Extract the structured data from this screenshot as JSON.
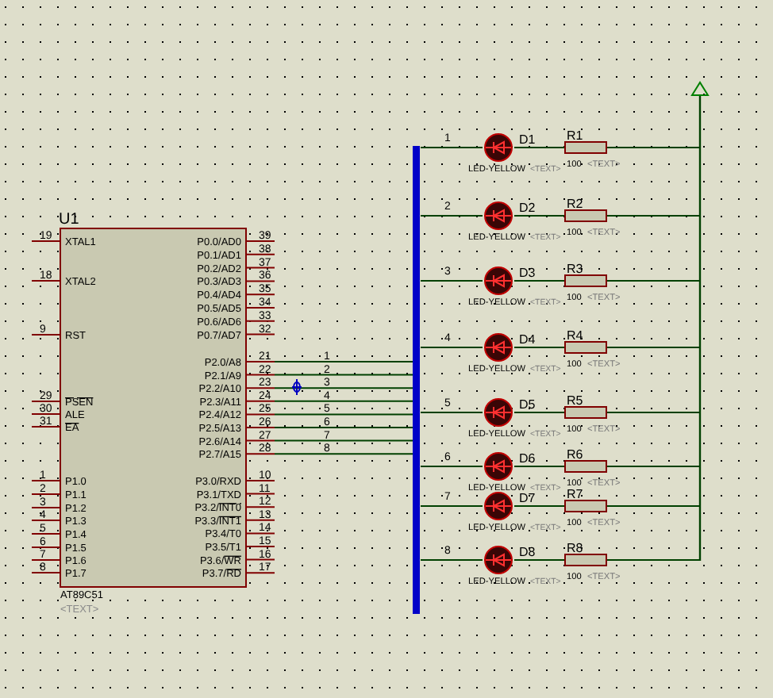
{
  "chip": {
    "ref": "U1",
    "part": "AT89C51",
    "text": "<TEXT>",
    "left_pins": [
      {
        "number": "19",
        "name": "XTAL1"
      },
      {
        "number": "18",
        "name": "XTAL2"
      },
      {
        "number": "9",
        "name": "RST"
      },
      {
        "number": "29",
        "bar": "PSEN"
      },
      {
        "number": "30",
        "name": "ALE"
      },
      {
        "number": "31",
        "bar": "EA"
      },
      {
        "number": "1",
        "name": "P1.0"
      },
      {
        "number": "2",
        "name": "P1.1"
      },
      {
        "number": "3",
        "name": "P1.2"
      },
      {
        "number": "4",
        "name": "P1.3"
      },
      {
        "number": "5",
        "name": "P1.4"
      },
      {
        "number": "6",
        "name": "P1.5"
      },
      {
        "number": "7",
        "name": "P1.6"
      },
      {
        "number": "8",
        "name": "P1.7"
      }
    ],
    "right_pins": [
      {
        "number": "39",
        "name": "P0.0/AD0"
      },
      {
        "number": "38",
        "name": "P0.1/AD1"
      },
      {
        "number": "37",
        "name": "P0.2/AD2"
      },
      {
        "number": "36",
        "name": "P0.3/AD3"
      },
      {
        "number": "35",
        "name": "P0.4/AD4"
      },
      {
        "number": "34",
        "name": "P0.5/AD5"
      },
      {
        "number": "33",
        "name": "P0.6/AD6"
      },
      {
        "number": "32",
        "name": "P0.7/AD7"
      },
      {
        "number": "21",
        "name": "P2.0/A8"
      },
      {
        "number": "22",
        "name": "P2.1/A9"
      },
      {
        "number": "23",
        "name": "P2.2/A10"
      },
      {
        "number": "24",
        "name": "P2.3/A11"
      },
      {
        "number": "25",
        "name": "P2.4/A12"
      },
      {
        "number": "26",
        "name": "P2.5/A13"
      },
      {
        "number": "27",
        "name": "P2.6/A14"
      },
      {
        "number": "28",
        "name": "P2.7/A15"
      },
      {
        "number": "10",
        "name": "P3.0/RXD"
      },
      {
        "number": "11",
        "name": "P3.1/TXD"
      },
      {
        "number": "12",
        "name": "P3.2/",
        "bar": "INT0"
      },
      {
        "number": "13",
        "name": "P3.3/",
        "bar": "INT1"
      },
      {
        "number": "14",
        "name": "P3.4/T0"
      },
      {
        "number": "15",
        "name": "P3.5/T1"
      },
      {
        "number": "16",
        "name": "P3.6/",
        "bar": "WR"
      },
      {
        "number": "17",
        "name": "P3.7/",
        "bar": "RD"
      }
    ]
  },
  "bus_labels": [
    "1",
    "2",
    "3",
    "4",
    "5",
    "6",
    "7",
    "8"
  ],
  "leds": [
    {
      "ref": "D1",
      "part": "LED-YELLOW",
      "text": "<TEXT>",
      "net": "1",
      "resistor": {
        "ref": "R1",
        "value": "100",
        "text": "<TEXT>"
      }
    },
    {
      "ref": "D2",
      "part": "LED-YELLOW",
      "text": "<TEXT>",
      "net": "2",
      "resistor": {
        "ref": "R2",
        "value": "100",
        "text": "<TEXT>"
      }
    },
    {
      "ref": "D3",
      "part": "LED-YELLOW",
      "text": "<TEXT>",
      "net": "3",
      "resistor": {
        "ref": "R3",
        "value": "100",
        "text": "<TEXT>"
      }
    },
    {
      "ref": "D4",
      "part": "LED-YELLOW",
      "text": "<TEXT>",
      "net": "4",
      "resistor": {
        "ref": "R4",
        "value": "100",
        "text": "<TEXT>"
      }
    },
    {
      "ref": "D5",
      "part": "LED-YELLOW",
      "text": "<TEXT>",
      "net": "5",
      "resistor": {
        "ref": "R5",
        "value": "100",
        "text": "<TEXT>"
      }
    },
    {
      "ref": "D6",
      "part": "LED-YELLOW",
      "text": "<TEXT>",
      "net": "6",
      "resistor": {
        "ref": "R6",
        "value": "100",
        "text": "<TEXT>"
      }
    },
    {
      "ref": "D7",
      "part": "LED-YELLOW",
      "text": "<TEXT>",
      "net": "7",
      "resistor": {
        "ref": "R7",
        "value": "100",
        "text": "<TEXT>"
      }
    },
    {
      "ref": "D8",
      "part": "LED-YELLOW",
      "text": "<TEXT>",
      "net": "8",
      "resistor": {
        "ref": "R8",
        "value": "100",
        "text": "<TEXT>"
      }
    }
  ]
}
